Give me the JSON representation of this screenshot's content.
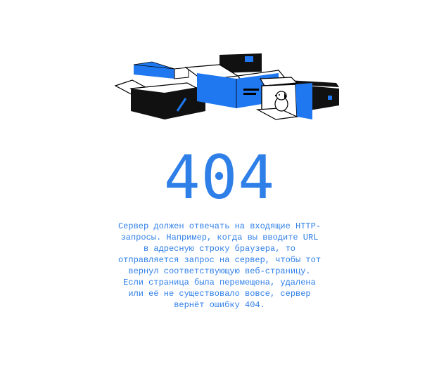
{
  "colors": {
    "accent": "#2f7fe8",
    "box_dark": "#111111",
    "box_blue": "#1f78f0",
    "outline": "#000000",
    "background": "#ffffff"
  },
  "illustration": {
    "icon": "open-boxes-with-dog-icon"
  },
  "error": {
    "code": "404",
    "message": "Сервер должен отвечать на входящие HTTP-\nзапросы. Например, когда вы вводите URL\nв адресную строку браузера, то\nотправляется запрос на сервер, чтобы тот\nвернул соответствующую веб-страницу.\nЕсли страница была перемещена, удалена\nили её не существовало вовсе, сервер\nвернёт ошибку 404."
  }
}
